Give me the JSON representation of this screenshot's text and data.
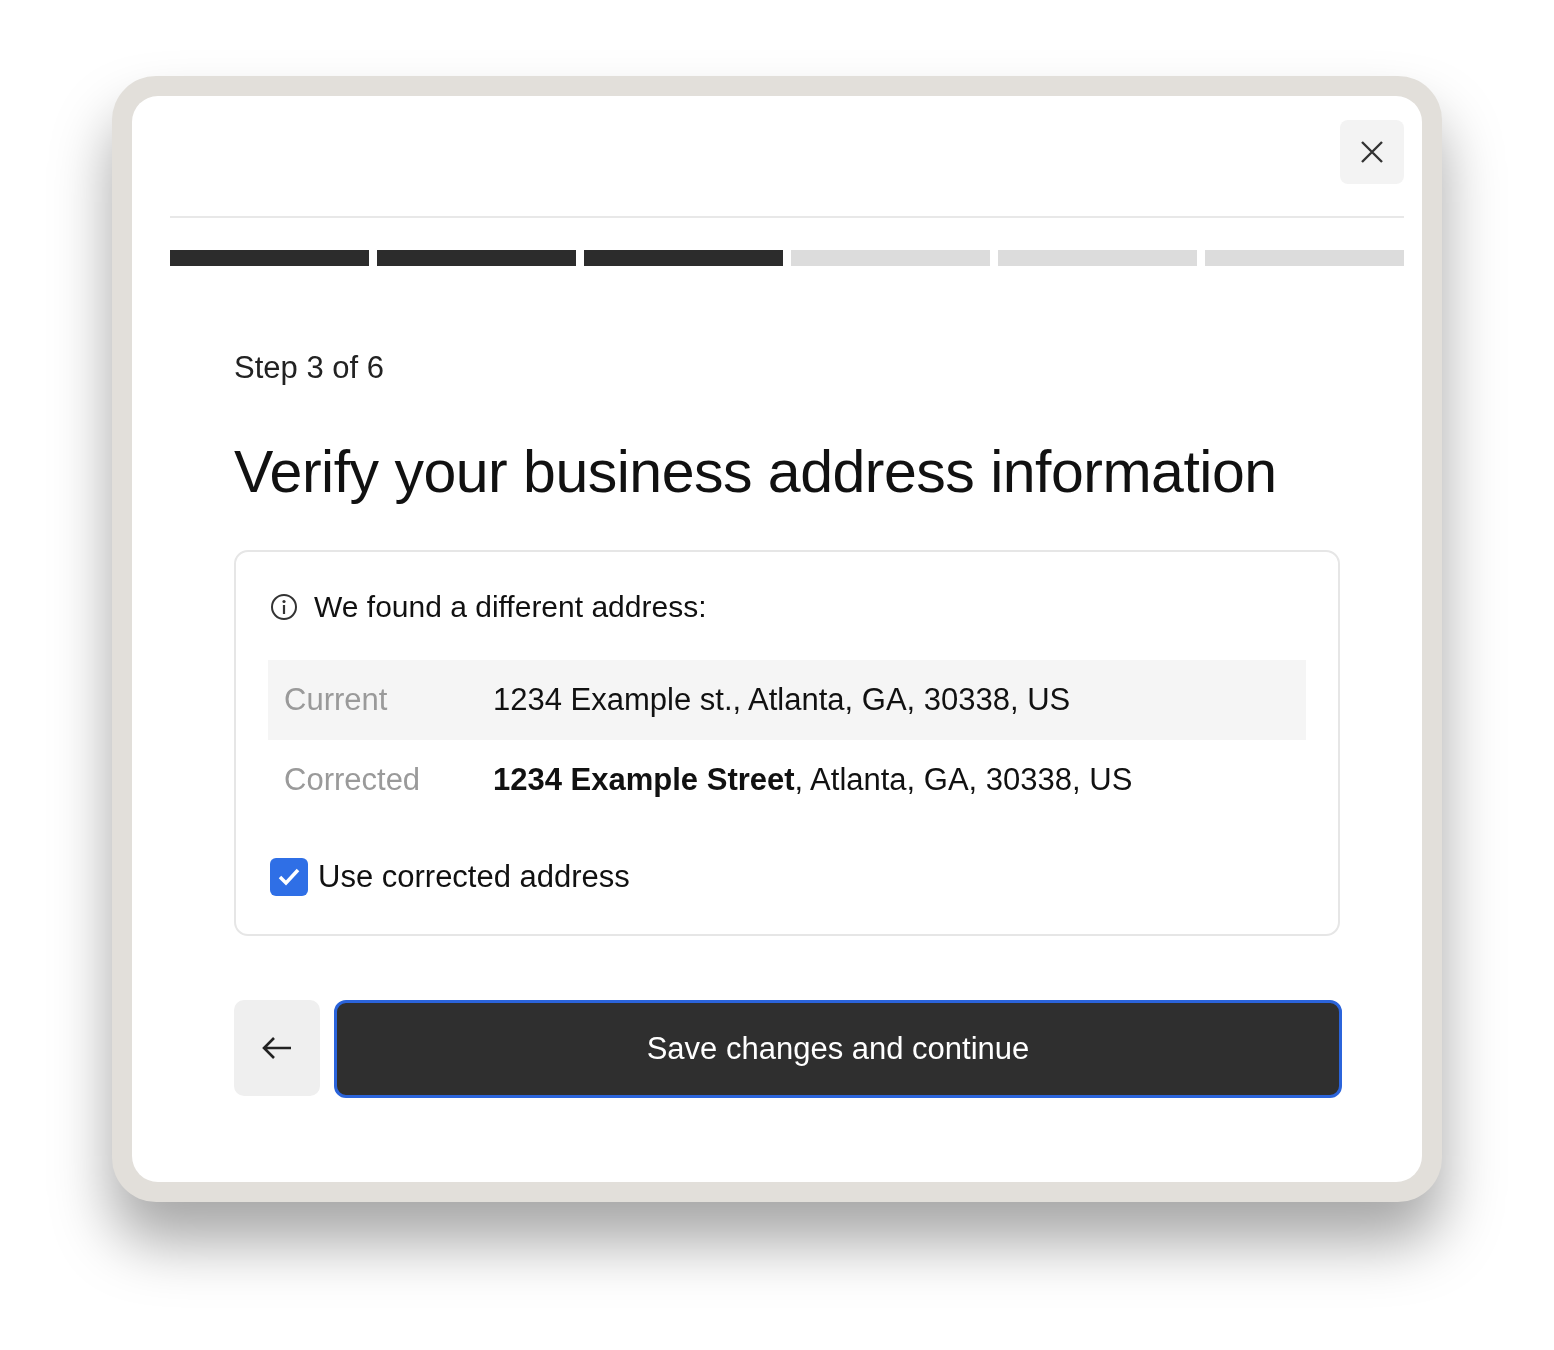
{
  "progress": [
    {
      "complete": true
    },
    {
      "complete": true
    },
    {
      "complete": true
    },
    {
      "complete": false
    },
    {
      "complete": false
    },
    {
      "complete": false
    }
  ],
  "step": "Step 3 of 6",
  "title": "Verify your business address information",
  "notice": "We found a different address:",
  "addresses": [
    {
      "label": "Current",
      "value": "1234 Example st., Atlanta, GA, 30338, US"
    },
    {
      "label": "Corrected",
      "value": "**1234 Example Street**, Atlanta, GA, 30338, US"
    }
  ],
  "checkbox": {
    "label": "Use corrected address",
    "checked": true
  },
  "primary_button": "Save changes and continue"
}
